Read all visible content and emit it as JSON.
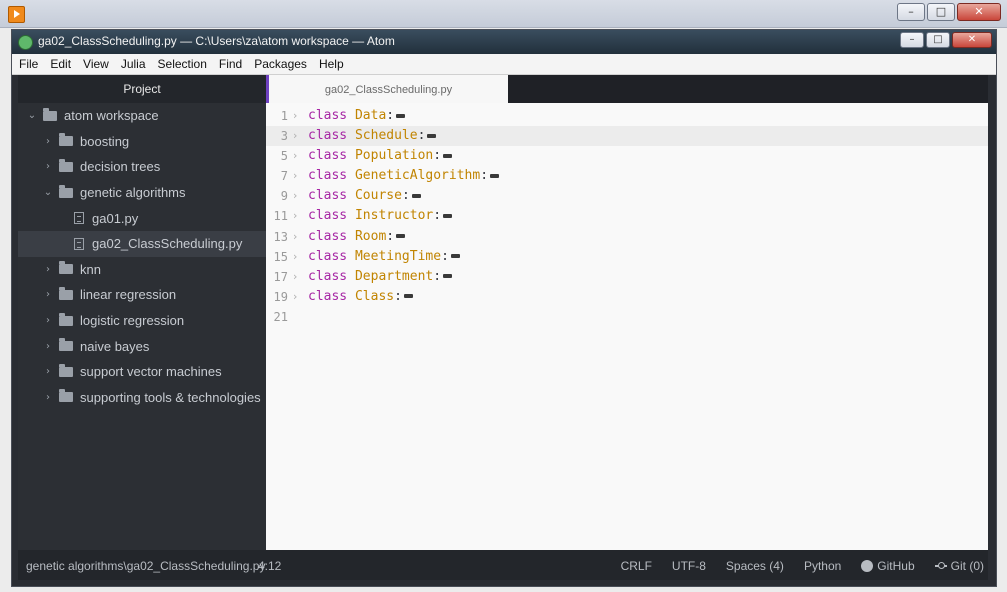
{
  "outer_window": {
    "buttons": [
      "minimize",
      "maximize",
      "close"
    ]
  },
  "atom": {
    "title": "ga02_ClassScheduling.py — C:\\Users\\za\\atom workspace — Atom",
    "menu": [
      "File",
      "Edit",
      "View",
      "Julia",
      "Selection",
      "Find",
      "Packages",
      "Help"
    ]
  },
  "sidebar": {
    "header": "Project",
    "tree": [
      {
        "label": "atom workspace",
        "type": "folder",
        "expanded": true,
        "depth": 0
      },
      {
        "label": "boosting",
        "type": "folder",
        "expanded": false,
        "depth": 1
      },
      {
        "label": "decision trees",
        "type": "folder",
        "expanded": false,
        "depth": 1
      },
      {
        "label": "genetic algorithms",
        "type": "folder",
        "expanded": true,
        "depth": 1
      },
      {
        "label": "ga01.py",
        "type": "file",
        "depth": 2
      },
      {
        "label": "ga02_ClassScheduling.py",
        "type": "file",
        "depth": 2,
        "selected": true
      },
      {
        "label": "knn",
        "type": "folder",
        "expanded": false,
        "depth": 1
      },
      {
        "label": "linear regression",
        "type": "folder",
        "expanded": false,
        "depth": 1
      },
      {
        "label": "logistic regression",
        "type": "folder",
        "expanded": false,
        "depth": 1
      },
      {
        "label": "naive bayes",
        "type": "folder",
        "expanded": false,
        "depth": 1
      },
      {
        "label": "support vector machines",
        "type": "folder",
        "expanded": false,
        "depth": 1
      },
      {
        "label": "supporting tools & technologies",
        "type": "folder",
        "expanded": false,
        "depth": 1
      }
    ]
  },
  "editor": {
    "tab_label": "ga02_ClassScheduling.py",
    "cursor_line": 3,
    "lines": [
      {
        "num": "1",
        "keyword": "class",
        "name": "Data",
        "folded": true
      },
      {
        "num": "3",
        "keyword": "class",
        "name": "Schedule",
        "folded": true
      },
      {
        "num": "5",
        "keyword": "class",
        "name": "Population",
        "folded": true
      },
      {
        "num": "7",
        "keyword": "class",
        "name": "GeneticAlgorithm",
        "folded": true
      },
      {
        "num": "9",
        "keyword": "class",
        "name": "Course",
        "folded": true
      },
      {
        "num": "11",
        "keyword": "class",
        "name": "Instructor",
        "folded": true
      },
      {
        "num": "13",
        "keyword": "class",
        "name": "Room",
        "folded": true
      },
      {
        "num": "15",
        "keyword": "class",
        "name": "MeetingTime",
        "folded": true
      },
      {
        "num": "17",
        "keyword": "class",
        "name": "Department",
        "folded": true
      },
      {
        "num": "19",
        "keyword": "class",
        "name": "Class",
        "folded": true
      },
      {
        "num": "21",
        "keyword": "",
        "name": "",
        "folded": false
      }
    ]
  },
  "status": {
    "path": "genetic algorithms\\ga02_ClassScheduling.py",
    "position": "4:12",
    "line_ending": "CRLF",
    "encoding": "UTF-8",
    "indent": "Spaces (4)",
    "grammar": "Python",
    "github": "GitHub",
    "git": "Git (0)"
  },
  "colors": {
    "keyword": "#a626a4",
    "class_name": "#c18401",
    "sidebar_bg": "#2c2f34",
    "editor_bg": "#f9f9f9",
    "tab_accent": "#6f42c1"
  }
}
